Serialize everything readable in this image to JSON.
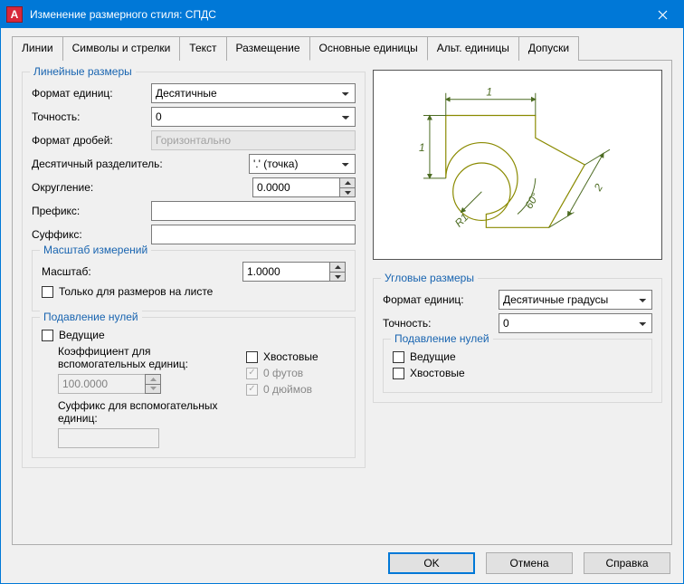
{
  "window": {
    "title": "Изменение размерного стиля: СПДС"
  },
  "tabs": [
    "Линии",
    "Символы и стрелки",
    "Текст",
    "Размещение",
    "Основные единицы",
    "Альт. единицы",
    "Допуски"
  ],
  "active_tab": 4,
  "linear": {
    "legend": "Линейные размеры",
    "unit_format_label": "Формат единиц:",
    "unit_format_value": "Десятичные",
    "precision_label": "Точность:",
    "precision_value": "0",
    "fraction_label": "Формат дробей:",
    "fraction_value": "Горизонтально",
    "decimal_sep_label": "Десятичный разделитель:",
    "decimal_sep_value": "'.' (точка)",
    "roundoff_label": "Округление:",
    "roundoff_value": "0.0000",
    "prefix_label": "Префикс:",
    "prefix_value": "",
    "suffix_label": "Суффикс:",
    "suffix_value": ""
  },
  "scale": {
    "legend": "Масштаб измерений",
    "scale_label": "Масштаб:",
    "scale_value": "1.0000",
    "layout_only_label": "Только для размеров на листе"
  },
  "zero": {
    "legend": "Подавление нулей",
    "leading_label": "Ведущие",
    "subfactor_label": "Коэффициент для вспомогательных единиц:",
    "subfactor_value": "100.0000",
    "subsuffix_label": "Суффикс для вспомогательных единиц:",
    "subsuffix_value": "",
    "trailing_label": "Хвостовые",
    "feet_label": "0 футов",
    "inches_label": "0 дюймов"
  },
  "angular": {
    "legend": "Угловые размеры",
    "unit_format_label": "Формат единиц:",
    "unit_format_value": "Десятичные градусы",
    "precision_label": "Точность:",
    "precision_value": "0",
    "zero_legend": "Подавление нулей",
    "leading_label": "Ведущие",
    "trailing_label": "Хвостовые"
  },
  "preview": {
    "d1": "1",
    "d2": "1",
    "d3": "2",
    "r": "R1",
    "ang": "60°"
  },
  "buttons": {
    "ok": "OK",
    "cancel": "Отмена",
    "help": "Справка"
  }
}
